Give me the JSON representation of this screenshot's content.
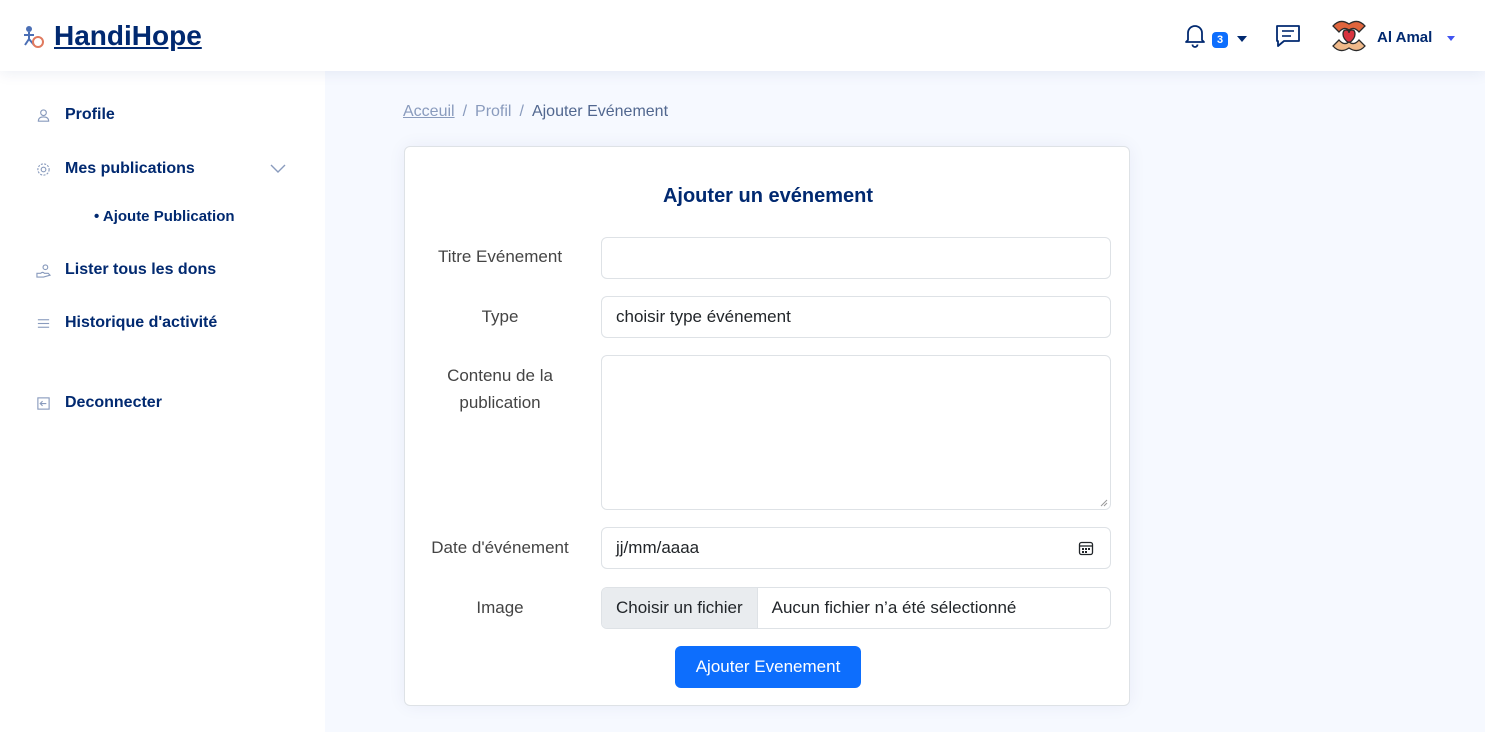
{
  "header": {
    "brand": "HandiHope",
    "notifications_count": "3",
    "user_name": "Al Amal",
    "icons": [
      "handihope-logo-icon",
      "bell-icon",
      "chat-icon",
      "avatar-icon"
    ]
  },
  "sidebar": {
    "items": [
      {
        "label": "Profile",
        "icon": "person-icon"
      },
      {
        "label": "Mes publications",
        "icon": "gear-icon"
      },
      {
        "label": "Lister tous les dons",
        "icon": "donate-icon"
      },
      {
        "label": "Historique d'activité",
        "icon": "list-icon"
      },
      {
        "label": "Deconnecter",
        "icon": "logout-icon"
      }
    ],
    "subitems": [
      "• Ajoute Publication"
    ]
  },
  "breadcrumb": {
    "items": [
      "Acceuil",
      "/",
      "Profil",
      "/",
      "Ajouter Evénement"
    ]
  },
  "form": {
    "title": "Ajouter un evénement",
    "fields": {
      "titre": {
        "label": "Titre Evénement",
        "value": ""
      },
      "type": {
        "label": "Type",
        "value": "choisir type événement"
      },
      "contenu": {
        "label": "Contenu de la publication",
        "value": ""
      },
      "date": {
        "label": "Date d'événement",
        "value": "jj/mm/aaaa"
      },
      "image": {
        "label": "Image",
        "button": "Choisir un fichier",
        "status": "Aucun fichier n’a été sélectionné"
      }
    },
    "submit_label": "Ajouter Evenement"
  },
  "colors": {
    "brand": "#012970",
    "primary": "#0d6efd",
    "background": "#f6f9ff",
    "muted": "#899bbd"
  }
}
